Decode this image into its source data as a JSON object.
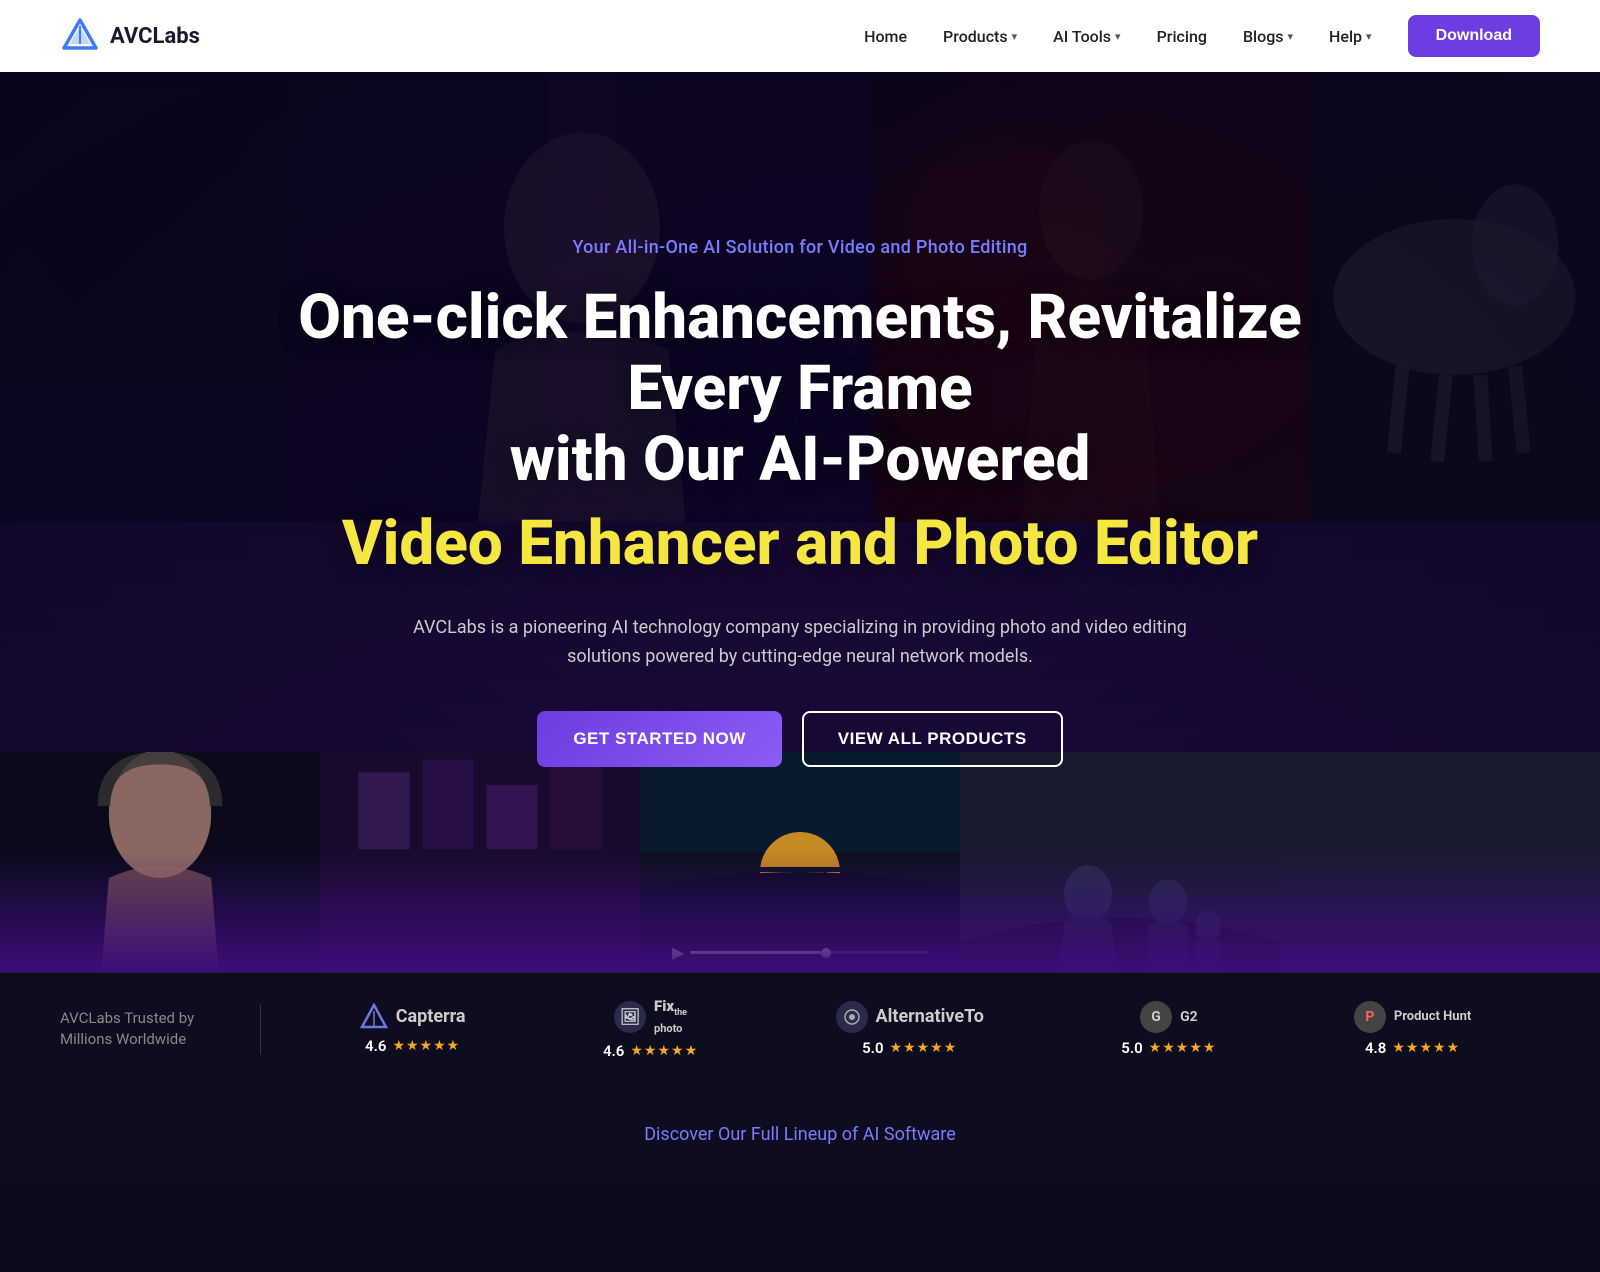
{
  "navbar": {
    "logo_text": "AVCLabs",
    "nav_items": [
      {
        "label": "Home",
        "has_dropdown": false
      },
      {
        "label": "Products",
        "has_dropdown": true
      },
      {
        "label": "AI Tools",
        "has_dropdown": true
      },
      {
        "label": "Pricing",
        "has_dropdown": false
      },
      {
        "label": "Blogs",
        "has_dropdown": true
      },
      {
        "label": "Help",
        "has_dropdown": true
      }
    ],
    "cta_label": "Download"
  },
  "hero": {
    "tagline": "Your All-in-One AI Solution for Video and Photo Editing",
    "title_line1": "One-click Enhancements, Revitalize Every Frame",
    "title_line2": "with Our AI-Powered",
    "title_accent": "Video Enhancer and Photo Editor",
    "description": "AVCLabs is a pioneering AI technology company specializing in providing photo and video editing solutions powered by cutting-edge neural network models.",
    "btn_primary": "GET STARTED NOW",
    "btn_secondary": "VIEW ALL PRODUCTS"
  },
  "trust_bar": {
    "intro_line1": "AVCLabs Trusted by",
    "intro_line2": "Millions Worldwide",
    "items": [
      {
        "name": "Capterra",
        "icon": "▷",
        "score": "4.6",
        "stars": 5,
        "partial": 0
      },
      {
        "name": "Fix the Photo",
        "icon": "🖼",
        "score": "4.6",
        "stars": 5,
        "partial": 0
      },
      {
        "name": "AlternativeTo",
        "icon": "◎",
        "score": "5.0",
        "stars": 5,
        "partial": 0
      },
      {
        "name": "G2",
        "icon": "G",
        "score": "5.0",
        "stars": 5,
        "partial": 0
      },
      {
        "name": "ProductHunt",
        "icon": "P",
        "score": "4.8",
        "stars": 5,
        "partial": 0
      }
    ]
  },
  "bottom": {
    "discover_text": "Discover Our Full Lineup of AI Software"
  }
}
